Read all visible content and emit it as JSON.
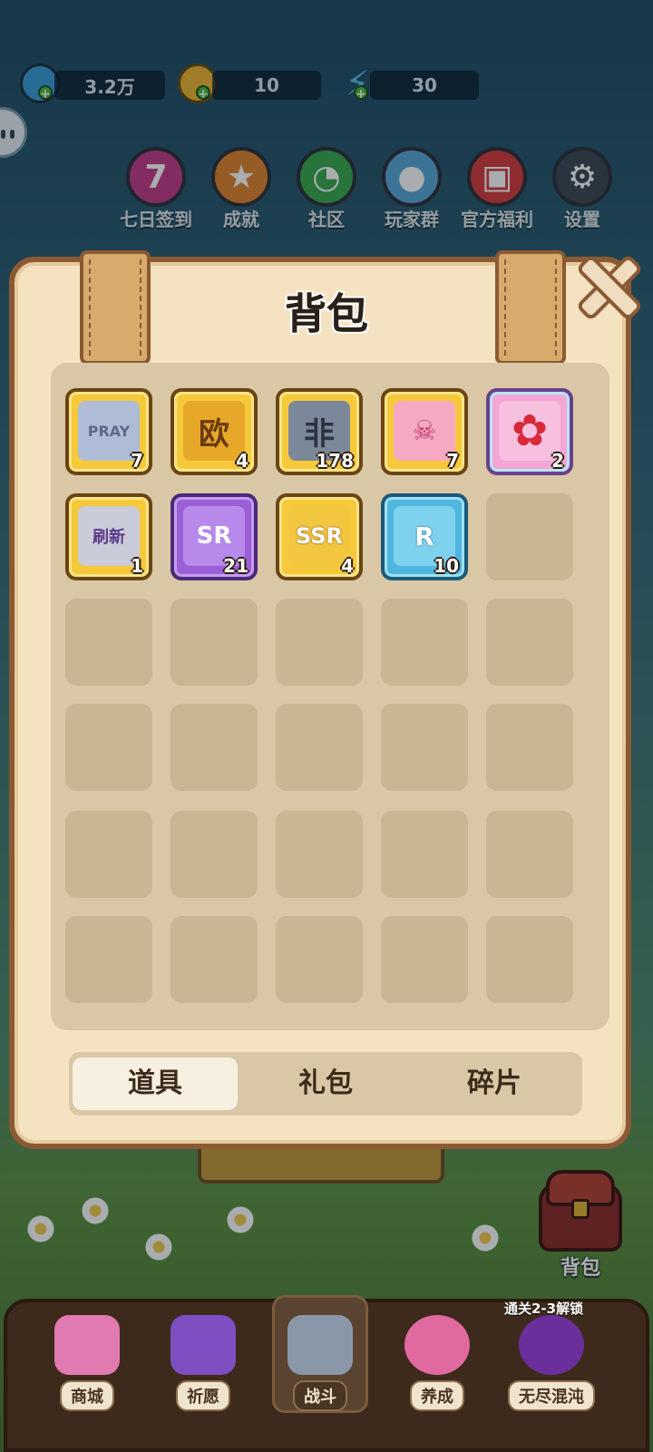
{
  "resources": [
    {
      "name": "gem",
      "value": "3.2万",
      "color": "#3a9bd8"
    },
    {
      "name": "coin",
      "value": "10",
      "color": "#f2b630"
    },
    {
      "name": "energy",
      "value": "30",
      "color": "#5bc0e8"
    }
  ],
  "menu": [
    {
      "label": "七日签到",
      "icon": "seven-day-icon",
      "glyph": "7",
      "color": "#c53a87"
    },
    {
      "label": "成就",
      "icon": "trophy-icon",
      "glyph": "★",
      "color": "#e0832a"
    },
    {
      "label": "社区",
      "icon": "chat-bubble-icon",
      "glyph": "◔",
      "color": "#3aa84a"
    },
    {
      "label": "玩家群",
      "icon": "penguin-icon",
      "glyph": "●",
      "color": "#5aa8d8"
    },
    {
      "label": "官方福利",
      "icon": "gift-icon",
      "glyph": "▣",
      "color": "#d83a3a"
    },
    {
      "label": "设置",
      "icon": "gear-icon",
      "glyph": "⚙",
      "color": "#3c4550"
    }
  ],
  "modal": {
    "title": "背包",
    "tabs": [
      "道具",
      "礼包",
      "碎片"
    ],
    "active_tab": 0
  },
  "items": [
    {
      "name": "pray-ticket",
      "art_text": "PRAY",
      "qty": "7",
      "theme": "gold",
      "art_color": "#aebcd6"
    },
    {
      "name": "ou-ticket",
      "art_text": "欧",
      "qty": "4",
      "theme": "gold",
      "art_color": "#e7a82a"
    },
    {
      "name": "fei-ticket",
      "art_text": "非",
      "qty": "178",
      "theme": "gold",
      "art_color": "#7b8899"
    },
    {
      "name": "pink-ticket",
      "art_text": "☠",
      "qty": "7",
      "theme": "gold",
      "art_color": "#f7a9c4"
    },
    {
      "name": "sakura-token",
      "art_text": "✿",
      "qty": "2",
      "theme": "pinkish",
      "art_color": "#d8283a"
    },
    {
      "name": "refresh-ticket",
      "art_text": "刷新",
      "qty": "1",
      "theme": "gold",
      "art_color": "#c9ccd8"
    },
    {
      "name": "sr-fragment",
      "art_text": "SR",
      "qty": "21",
      "theme": "purple",
      "art_color": "#b689ea"
    },
    {
      "name": "ssr-fragment",
      "art_text": "SSR",
      "qty": "4",
      "theme": "gold",
      "art_color": "#f3c640"
    },
    {
      "name": "r-fragment",
      "art_text": "R",
      "qty": "10",
      "theme": "blue",
      "art_color": "#7fd2ee"
    }
  ],
  "backpack_button": {
    "label": "背包"
  },
  "bottom_nav": {
    "unlock_note": "通关2-3解锁",
    "items": [
      {
        "label": "商城",
        "icon": "shop-icon",
        "color": "#e07ab0"
      },
      {
        "label": "祈愿",
        "icon": "wish-card-icon",
        "color": "#7d4fc0"
      },
      {
        "label": "战斗",
        "icon": "crossed-swords-icon",
        "color": "#8a97a8"
      },
      {
        "label": "养成",
        "icon": "paw-icon",
        "color": "#e06aa0"
      },
      {
        "label": "无尽混沌",
        "icon": "lock-icon",
        "color": "#6a2f9a"
      }
    ]
  }
}
